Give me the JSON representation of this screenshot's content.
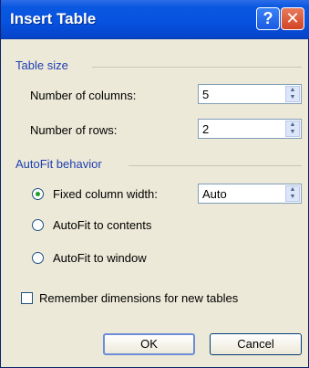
{
  "window": {
    "title": "Insert Table"
  },
  "titlebar": {
    "help_glyph": "?",
    "close_glyph": "✕"
  },
  "table_size": {
    "group_label": "Table size",
    "columns_label": "Number of columns:",
    "columns_value": "5",
    "rows_label": "Number of rows:",
    "rows_value": "2"
  },
  "autofit": {
    "group_label": "AutoFit behavior",
    "options": [
      {
        "label": "Fixed column width:",
        "checked": true
      },
      {
        "label": "AutoFit to contents",
        "checked": false
      },
      {
        "label": "AutoFit to window",
        "checked": false
      }
    ],
    "fixed_width_value": "Auto"
  },
  "remember": {
    "label": "Remember dimensions for new tables",
    "checked": false
  },
  "buttons": {
    "ok": "OK",
    "cancel": "Cancel"
  },
  "colors": {
    "title_bar": "#0753E1",
    "dialog_bg": "#ECE9D8",
    "group_label": "#1F3FB0"
  },
  "icons": {
    "spin_up": "▲",
    "spin_down": "▼"
  }
}
